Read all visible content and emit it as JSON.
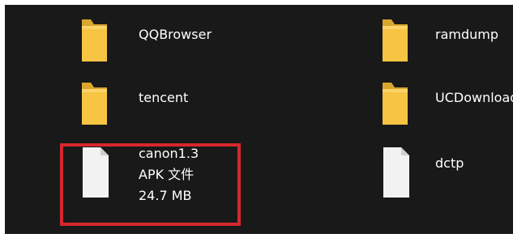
{
  "colors": {
    "pane_background": "#191919",
    "text": "#ffffff",
    "folder": "#f5c242",
    "selection_outline": "#d6282d"
  },
  "files": [
    {
      "name": "QQBrowser",
      "icon": "folder-icon"
    },
    {
      "name": "ramdump",
      "icon": "folder-icon"
    },
    {
      "name": "tencent",
      "icon": "folder-icon"
    },
    {
      "name": "UCDownloads",
      "icon": "folder-icon"
    },
    {
      "name": "canon1.3",
      "type": "APK 文件",
      "size": "24.7 MB",
      "icon": "file-icon",
      "highlighted": true
    },
    {
      "name": "dctp",
      "icon": "file-icon"
    }
  ]
}
